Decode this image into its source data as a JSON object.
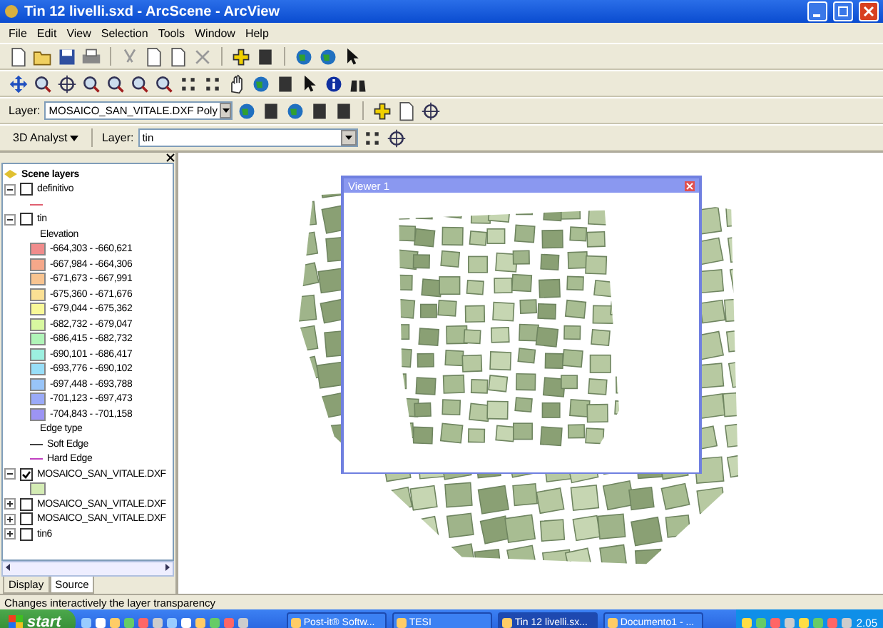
{
  "window": {
    "title": "Tin 12 livelli.sxd - ArcScene - ArcView"
  },
  "menu": [
    "File",
    "Edit",
    "View",
    "Selection",
    "Tools",
    "Window",
    "Help"
  ],
  "layer_toolbar": {
    "label": "Layer:",
    "value": "MOSAICO_SAN_VITALE.DXF Poly"
  },
  "analyst_toolbar": {
    "menu": "3D Analyst",
    "label": "Layer:",
    "value": "tin"
  },
  "toc": {
    "title": "Scene layers",
    "layers": [
      {
        "name": "definitivo",
        "checked": false,
        "expanded": true,
        "legend": [
          {
            "kind": "line",
            "color": "#e06070"
          }
        ]
      },
      {
        "name": "tin",
        "checked": false,
        "expanded": true,
        "legend": [
          {
            "kind": "heading",
            "label": "Elevation"
          },
          {
            "kind": "class",
            "label": "-664,303 - -660,621",
            "color": "#f08c8c"
          },
          {
            "kind": "class",
            "label": "-667,984 - -664,306",
            "color": "#f5a88a"
          },
          {
            "kind": "class",
            "label": "-671,673 - -667,991",
            "color": "#f8c490"
          },
          {
            "kind": "class",
            "label": "-675,360 - -671,676",
            "color": "#fbe094"
          },
          {
            "kind": "class",
            "label": "-679,044 - -675,362",
            "color": "#f8f898"
          },
          {
            "kind": "class",
            "label": "-682,732 - -679,047",
            "color": "#d8f8a0"
          },
          {
            "kind": "class",
            "label": "-686,415 - -682,732",
            "color": "#b0f4b8"
          },
          {
            "kind": "class",
            "label": "-690,101 - -686,417",
            "color": "#9cf0e0"
          },
          {
            "kind": "class",
            "label": "-693,776 - -690,102",
            "color": "#98def8"
          },
          {
            "kind": "class",
            "label": "-697,448 - -693,788",
            "color": "#98c4f8"
          },
          {
            "kind": "class",
            "label": "-701,123 - -697,473",
            "color": "#9aaaf8"
          },
          {
            "kind": "class",
            "label": "-704,843 - -701,158",
            "color": "#9c94f4"
          },
          {
            "kind": "heading",
            "label": "Edge type"
          },
          {
            "kind": "edge",
            "label": "Soft Edge",
            "color": "#404040"
          },
          {
            "kind": "edge",
            "label": "Hard Edge",
            "color": "#c040c0"
          }
        ]
      },
      {
        "name": "MOSAICO_SAN_VITALE.DXF",
        "checked": true,
        "expanded": true,
        "legend": [
          {
            "kind": "fill",
            "color": "#d4ecb4"
          }
        ]
      },
      {
        "name": "MOSAICO_SAN_VITALE.DXF",
        "checked": false,
        "expanded": false
      },
      {
        "name": "MOSAICO_SAN_VITALE.DXF",
        "checked": false,
        "expanded": false
      },
      {
        "name": "tin6",
        "checked": false,
        "expanded": false
      }
    ]
  },
  "toc_tabs": [
    {
      "label": "Display",
      "selected": false
    },
    {
      "label": "Source",
      "selected": true
    }
  ],
  "viewer": {
    "title": "Viewer 1"
  },
  "status_bar": {
    "text": "Changes interactively the layer transparency"
  },
  "taskbar": {
    "start": "start",
    "tasks": [
      {
        "label": "Post-it® Softw...",
        "selected": false
      },
      {
        "label": "TESI",
        "selected": false
      },
      {
        "label": "Tin 12 livelli.sx...",
        "selected": true
      },
      {
        "label": "Documento1 - ...",
        "selected": false
      }
    ],
    "clock": "2.05"
  }
}
